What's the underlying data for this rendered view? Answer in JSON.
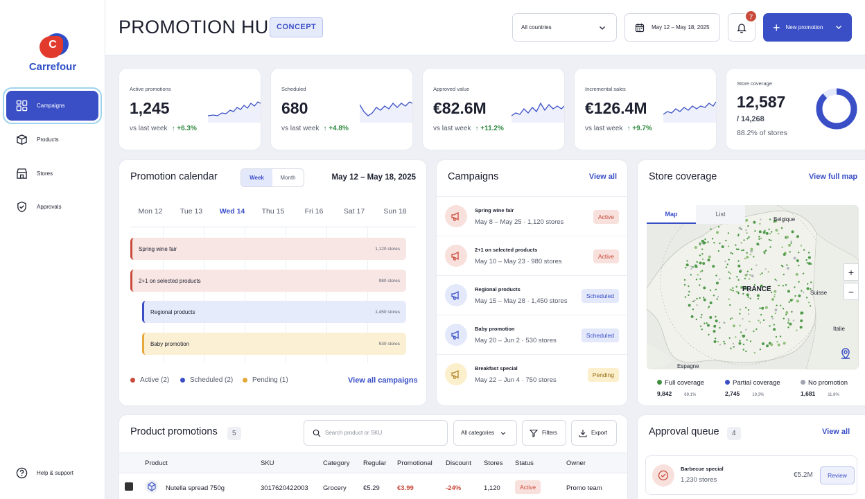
{
  "brand": {
    "name": "Carrefour",
    "logo_letter": "C"
  },
  "sidebar": {
    "items": [
      {
        "label": "Campaigns",
        "icon": "grid-icon"
      },
      {
        "label": "Products",
        "icon": "package-icon"
      },
      {
        "label": "Stores",
        "icon": "store-icon"
      },
      {
        "label": "Approvals",
        "icon": "shield-check-icon"
      }
    ],
    "help": "Help & support"
  },
  "header": {
    "title": "PROMOTION HUB",
    "badge": "CONCEPT",
    "country": "All countries",
    "date_range": "May 12 – May 18, 2025",
    "notifications": "7",
    "new_button": "New promotion"
  },
  "kpis": [
    {
      "label": "Active promotions",
      "value": "1,245",
      "foot": "vs last week",
      "delta": "↑ +6.3%"
    },
    {
      "label": "Scheduled",
      "value": "680",
      "foot": "vs last week",
      "delta": "↑ +4.8%"
    },
    {
      "label": "Approved value",
      "value": "€82.6M",
      "foot": "vs last week",
      "delta": "↑ +11.2%"
    },
    {
      "label": "Incremental sales",
      "value": "€126.4M",
      "foot": "vs last week",
      "delta": "↑ +9.7%"
    }
  ],
  "coverage_kpi": {
    "label": "Store coverage",
    "value": "12,587",
    "total": "/ 14,268",
    "pct": "88.2% of stores",
    "fraction": 0.882
  },
  "calendar": {
    "title": "Promotion calendar",
    "view_week": "Week",
    "view_month": "Month",
    "range": "May 12 – May 18, 2025",
    "days": [
      "Mon 12",
      "Tue 13",
      "Wed 14",
      "Thu 15",
      "Fri 16",
      "Sat 17",
      "Sun 18"
    ],
    "bars": [
      {
        "name": "Spring wine fair",
        "stores": "1,120 stores",
        "status": "active"
      },
      {
        "name": "2+1 on selected products",
        "stores": "980 stores",
        "status": "active"
      },
      {
        "name": "Regional products",
        "stores": "1,450 stores",
        "status": "scheduled"
      },
      {
        "name": "Baby promotion",
        "stores": "530 stores",
        "status": "pending"
      }
    ],
    "legend": [
      "Active (2)",
      "Scheduled (2)",
      "Pending (1)"
    ],
    "view_all": "View all campaigns"
  },
  "campaigns": {
    "title": "Campaigns",
    "view_all": "View all",
    "items": [
      {
        "name": "Spring wine fair",
        "meta": "May 8 – May 25 · 1,120 stores",
        "status": "Active"
      },
      {
        "name": "2+1 on selected products",
        "meta": "May 10 – May 23 · 980 stores",
        "status": "Active"
      },
      {
        "name": "Regional products",
        "meta": "May 15 – May 28 · 1,450 stores",
        "status": "Scheduled"
      },
      {
        "name": "Baby promotion",
        "meta": "May 20 – Jun 2 · 530 stores",
        "status": "Scheduled"
      },
      {
        "name": "Breakfast special",
        "meta": "May 22 – Jun 4 · 750 stores",
        "status": "Pending"
      }
    ]
  },
  "store_coverage": {
    "title": "Store coverage",
    "view_map": "View full map",
    "tab_map": "Map",
    "tab_list": "List",
    "labels": {
      "belgique": "Belgique",
      "france": "FRANCE",
      "suisse": "Suisse",
      "italie": "Italie",
      "espagne": "Espagne"
    },
    "legend": [
      {
        "label": "Full coverage",
        "count": "9,842",
        "pct": "69.1%",
        "color": "#3f8f3f"
      },
      {
        "label": "Partial coverage",
        "count": "2,745",
        "pct": "19.3%",
        "color": "#3a4fc6"
      },
      {
        "label": "No promotion",
        "count": "1,681",
        "pct": "11.8%",
        "color": "#a0a4ae"
      }
    ]
  },
  "products": {
    "title": "Product promotions",
    "count": "5",
    "search_placeholder": "Search product or SKU",
    "category": "All categories",
    "filters": "Filters",
    "export": "Export",
    "columns": [
      "Product",
      "SKU",
      "Category",
      "Regular",
      "Promotional",
      "Discount",
      "Stores",
      "Status",
      "Owner"
    ],
    "rows": [
      {
        "product": "Nutella spread 750g",
        "sku": "3017620422003",
        "category": "Grocery",
        "regular": "€5.29",
        "promo": "€3.99",
        "discount": "-24%",
        "stores": "1,120",
        "status": "Active",
        "owner": "Promo team"
      }
    ]
  },
  "approvals": {
    "title": "Approval queue",
    "count": "4",
    "view_all": "View all",
    "items": [
      {
        "name": "Barbecue special",
        "stores": "1,230 stores",
        "value": "€5.2M",
        "action": "Review"
      }
    ]
  }
}
